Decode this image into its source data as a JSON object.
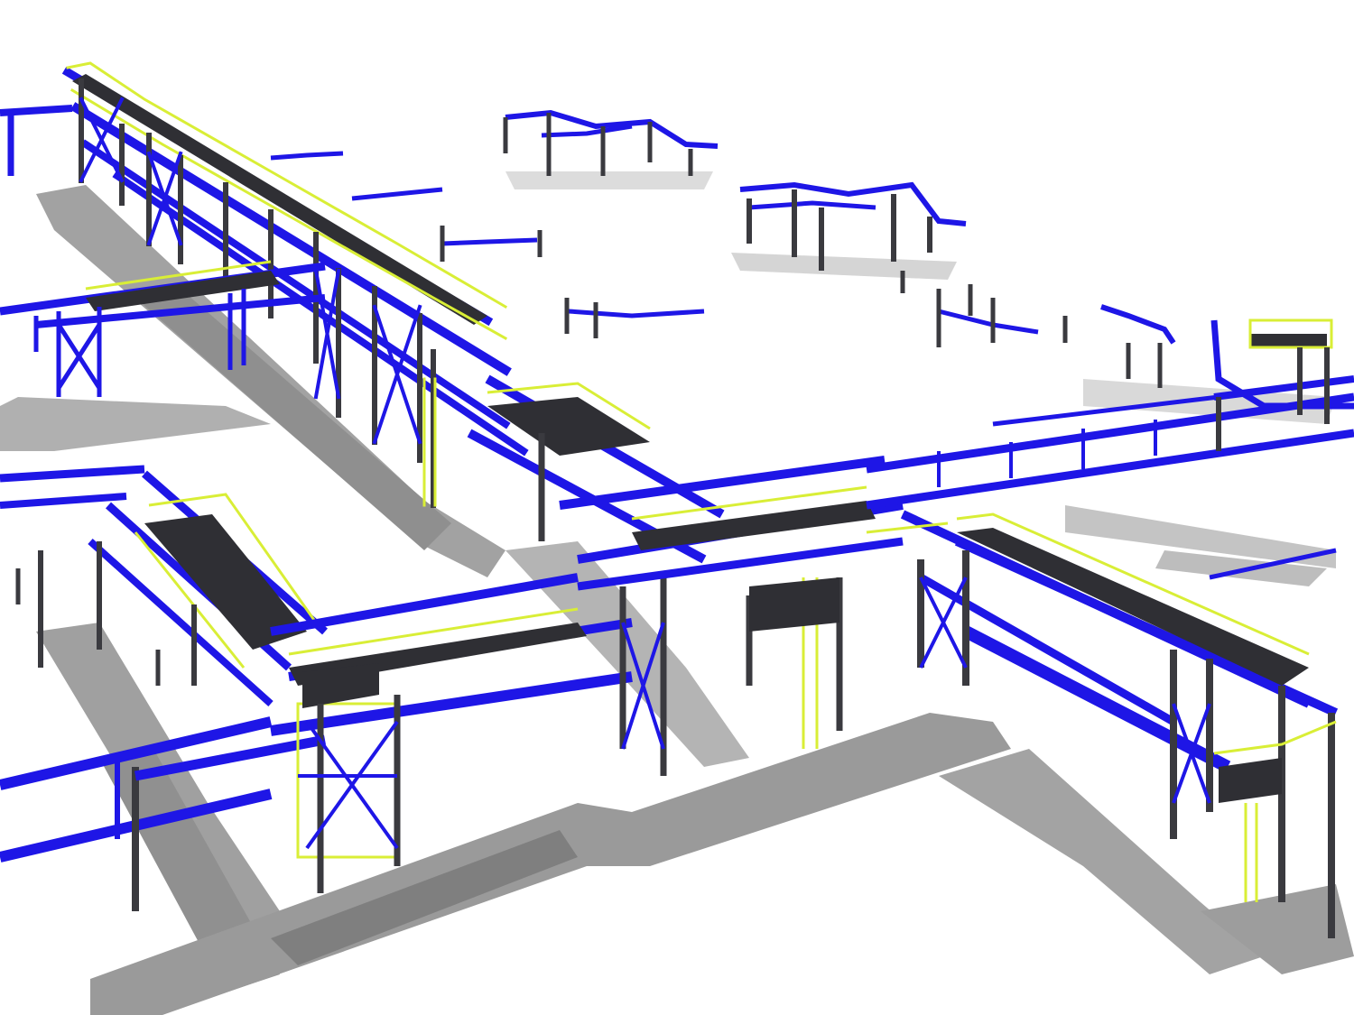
{
  "scene": {
    "kind": "3d-steel-pipe-rack-render",
    "colors": {
      "background": "#ffffff",
      "steel_beam": "#1e16e6",
      "column": "#3a3a3f",
      "walkway_grating": "#2f2f34",
      "handrail": "#d9ee36",
      "shadow": "#9c9c9c",
      "shadow_dark": "#7d7d7d"
    },
    "legend": [],
    "labels": []
  }
}
